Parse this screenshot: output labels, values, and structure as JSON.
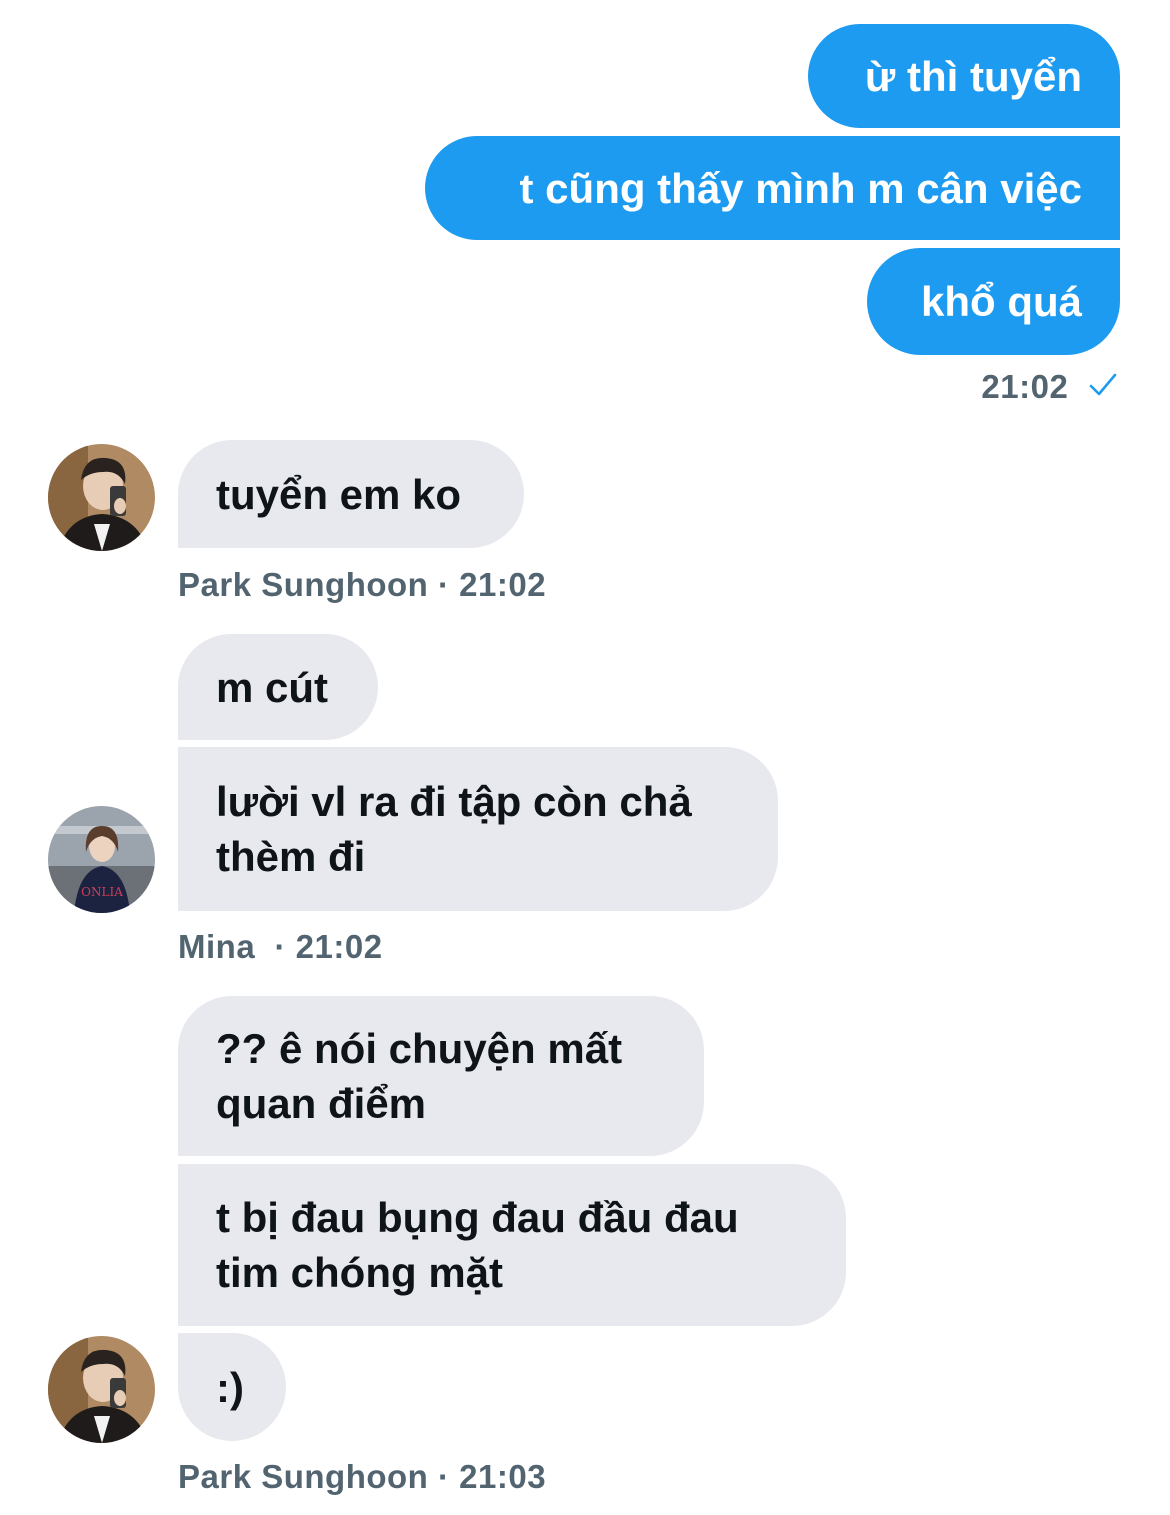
{
  "outgoing": {
    "messages": [
      "ừ thì tuyển",
      "t cũng thấy mình m cân việc",
      "khổ quá"
    ],
    "time": "21:02",
    "status_icon": "check-icon",
    "accent": "#1d9bf0"
  },
  "incoming": [
    {
      "sender": "Park Sunghoon",
      "time": "21:02",
      "messages": [
        "tuyển em ko"
      ]
    },
    {
      "sender": "Mina",
      "time": "21:02",
      "messages": [
        "m cút",
        "lười vl ra đi tập còn chả thèm đi"
      ]
    },
    {
      "sender": "Park Sunghoon",
      "time": "21:03",
      "messages": [
        "?? ê nói chuyện mất quan điểm",
        "t bị đau bụng đau đầu đau tim chóng mặt",
        ":)"
      ]
    }
  ],
  "separator": " · "
}
